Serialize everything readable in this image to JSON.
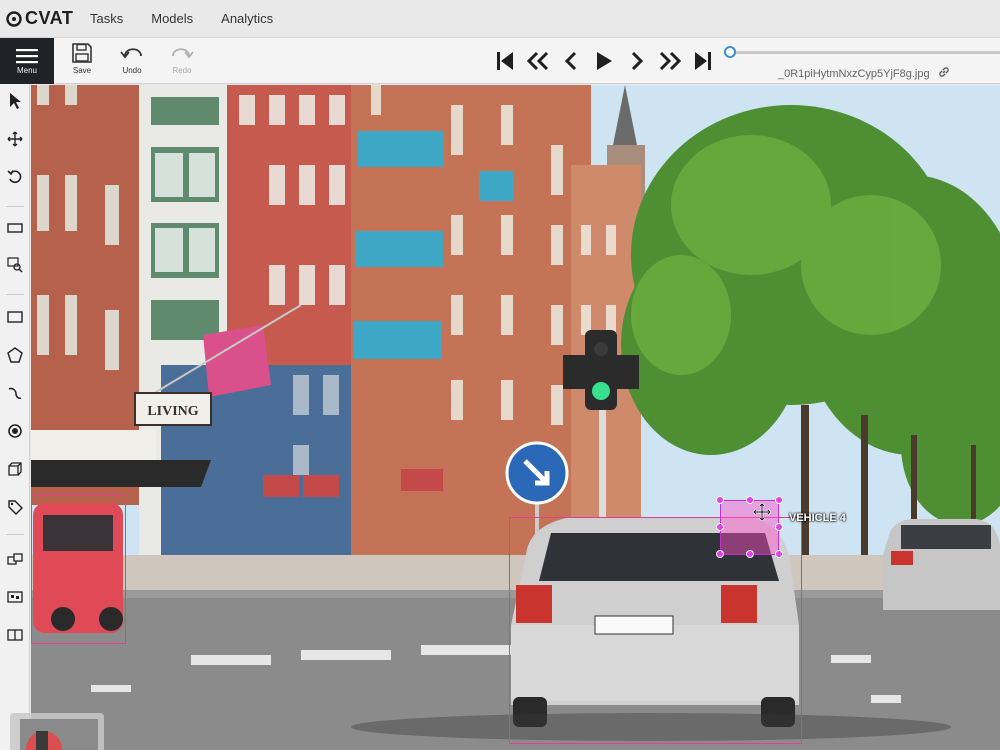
{
  "app": {
    "logo_text": "CVAT"
  },
  "topnav": {
    "items": [
      {
        "label": "Tasks"
      },
      {
        "label": "Models"
      },
      {
        "label": "Analytics"
      }
    ]
  },
  "header": {
    "menu_label": "Menu",
    "save_label": "Save",
    "undo_label": "Undo",
    "redo_label": "Redo",
    "filename": "_0R1piHytmNxzCyp5YjF8g.jpg",
    "frame_progress": 0
  },
  "player": {
    "buttons": [
      "first-frame",
      "fast-backward",
      "previous-frame",
      "play",
      "next-frame",
      "fast-forward",
      "last-frame"
    ]
  },
  "sidebar": {
    "tools": [
      "cursor",
      "move",
      "rotate",
      "fit-image",
      "zoom-region",
      "draw-rectangle",
      "draw-polygon",
      "draw-polyline",
      "draw-points",
      "draw-cuboid",
      "setup-tag",
      "merge-shapes",
      "group-shapes",
      "split-track"
    ]
  },
  "canvas": {
    "annotations": [
      {
        "label": "VEHICLE 4",
        "color": "#c02fd0"
      }
    ],
    "scene_text": {
      "shop_sign": "LIVING"
    }
  },
  "colors": {
    "menu_bg": "#1f2327",
    "bbox_main": "#e0408f",
    "bbox_selected": "#c02fd0",
    "accent": "#3a8fd8"
  }
}
